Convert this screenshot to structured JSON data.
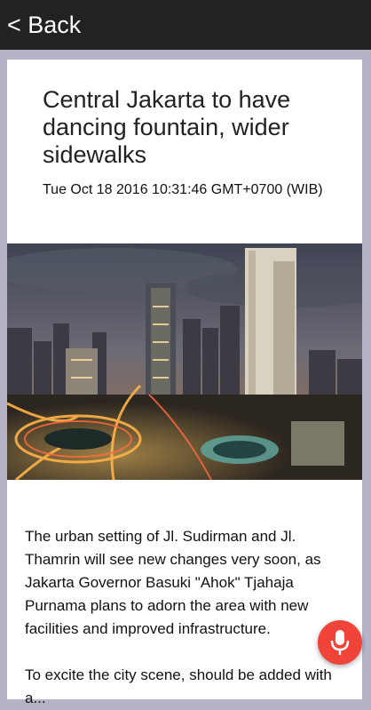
{
  "topbar": {
    "back_label": "< Back"
  },
  "article": {
    "title": "Central Jakarta to have dancing fountain, wider sidewalks",
    "date": "Tue Oct 18 2016 10:31:46 GMT+0700 (WIB)",
    "image_alt": "Jakarta city skyline at dusk",
    "paragraphs": [
      "The urban setting of Jl. Sudirman and Jl. Thamrin will see new changes very soon, as Jakarta Governor Basuki \"Ahok\" Tjahaja Purnama plans to adorn the area with new facilities and improved infrastructure.",
      "To excite the city scene, should be added with a..."
    ]
  },
  "mic": {
    "icon": "microphone-icon",
    "color": "#f0433a"
  },
  "colors": {
    "topbar": "#222222",
    "background": "#b6b3c8",
    "card": "#ffffff"
  }
}
